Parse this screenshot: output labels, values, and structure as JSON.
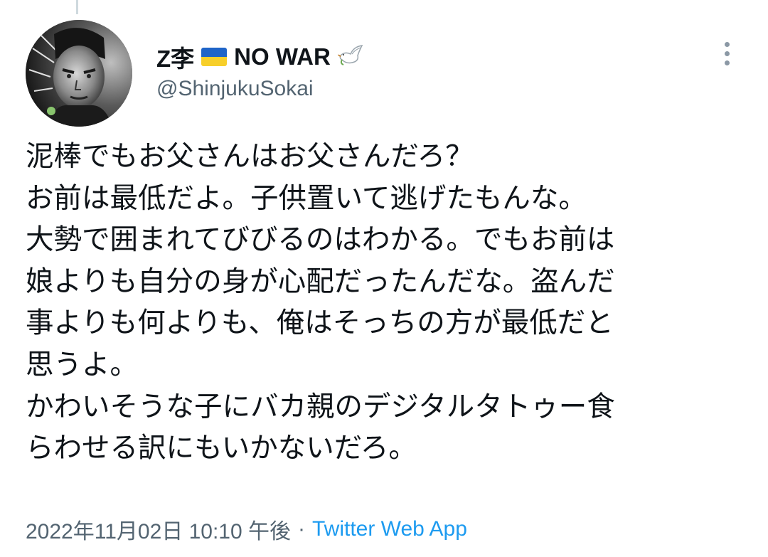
{
  "user": {
    "display_name": "Z李",
    "flag_icon": "ukraine-flag-icon",
    "no_war": "NO WAR",
    "dove_icon": "dove-icon",
    "handle": "@ShinjukuSokai"
  },
  "menu": {
    "icon": "more-vertical-icon"
  },
  "tweet": {
    "lines": [
      "泥棒でもお父さんはお父さんだろ？",
      "お前は最低だよ。子供置いて逃げたもんな。",
      "大勢で囲まれてびびるのはわかる。でもお前は",
      "娘よりも自分の身が心配だったんだな。盗んだ",
      "事よりも何よりも、俺はそっちの方が最低だと",
      "思うよ。",
      "かわいそうな子にバカ親のデジタルタトゥー食",
      "らわせる訳にもいかないだろ。"
    ]
  },
  "meta": {
    "timestamp": "2022年11月02日 10:10 午後",
    "separator": "·",
    "source": "Twitter Web App"
  },
  "colors": {
    "text": "#0f1419",
    "secondary": "#536471",
    "link": "#1d9bf0",
    "flag_blue": "#1f64c8",
    "flag_yellow": "#f7cf2a"
  }
}
